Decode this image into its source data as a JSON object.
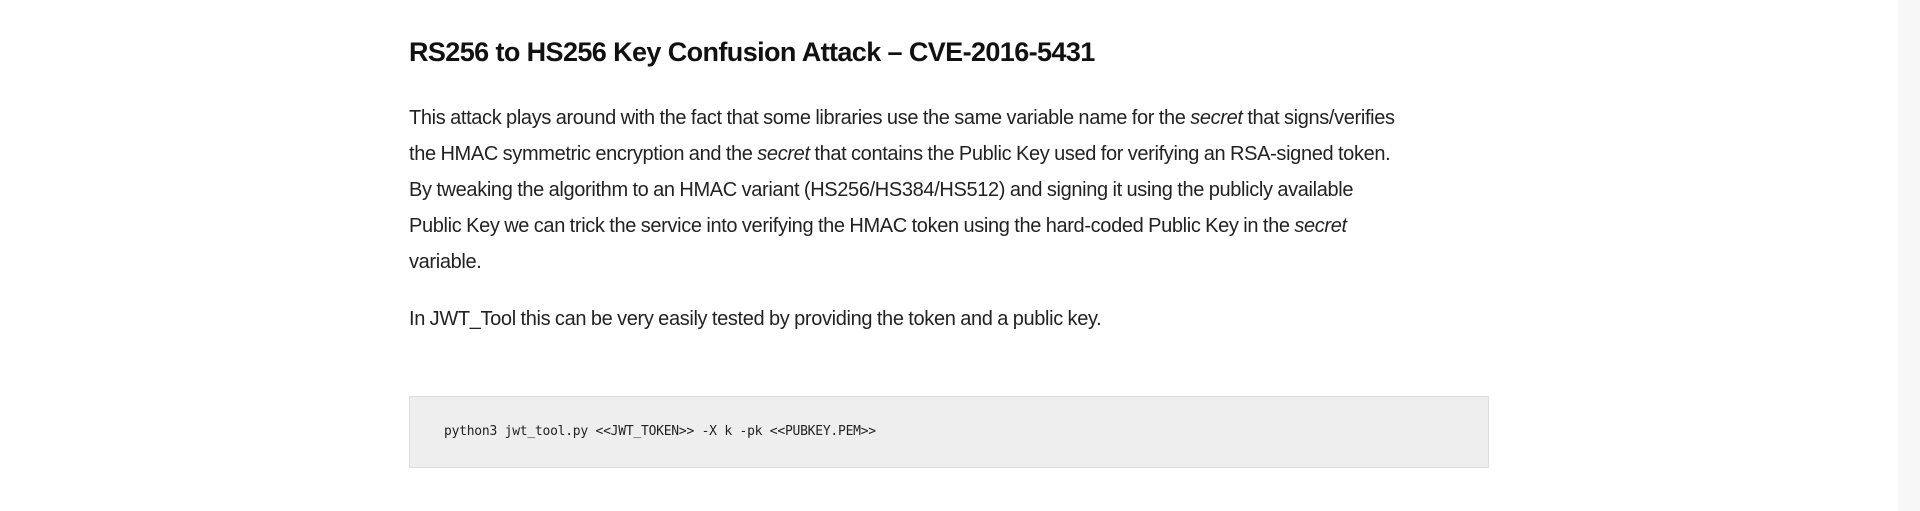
{
  "article": {
    "heading": "RS256 to HS256 Key Confusion Attack – CVE-2016-5431",
    "paragraph_1": {
      "lines": [
        [
          "This attack plays around with the fact that some libraries use the same variable name for the ",
          "secret",
          " that signs/verifies"
        ],
        [
          "the HMAC symmetric encryption and the ",
          "secret",
          " that contains the Public Key used for verifying an RSA-signed token."
        ],
        [
          "By tweaking the algorithm to an HMAC variant (HS256/HS384/HS512) and signing it using the publicly available"
        ],
        [
          "Public Key we can trick the service into verifying the HMAC token using the hard-coded Public Key in the ",
          "secret"
        ],
        [
          "variable."
        ]
      ]
    },
    "paragraph_2": "In JWT_Tool this can be very easily tested by providing the token and a public key.",
    "code_block": "python3 jwt_tool.py <<JWT_TOKEN>> -X k -pk <<PUBKEY.PEM>>"
  }
}
